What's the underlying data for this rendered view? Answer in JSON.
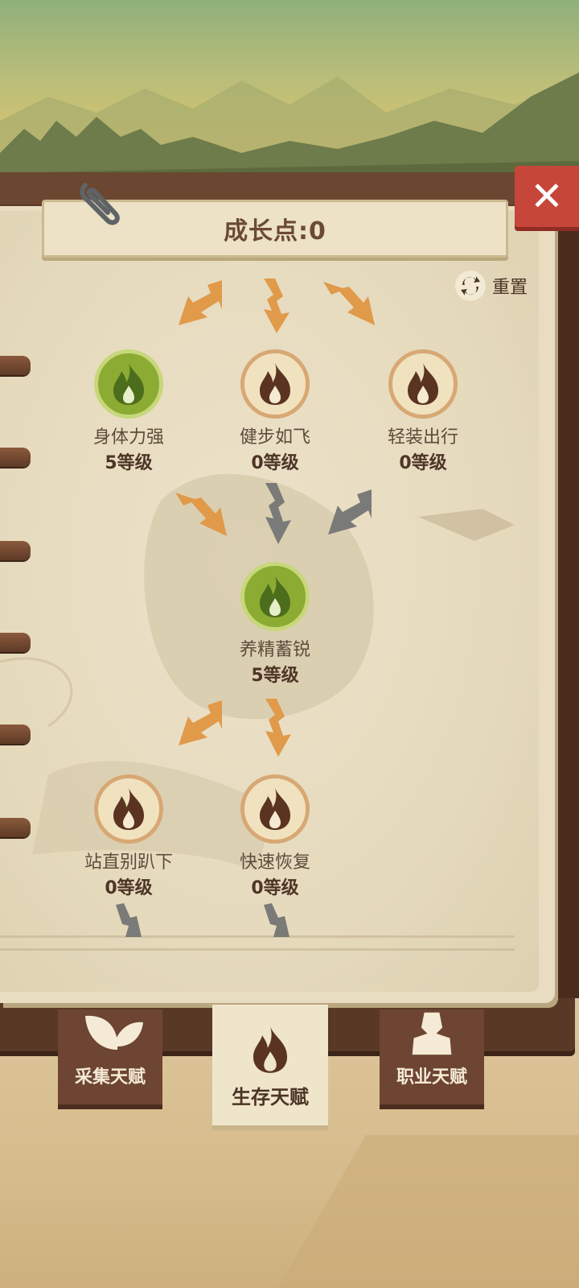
{
  "header": {
    "title": "成长点:0",
    "reset_label": "重置",
    "close_glyph": "✕"
  },
  "talents": [
    {
      "name": "身体力强",
      "level": "5等级",
      "state": "active"
    },
    {
      "name": "健步如飞",
      "level": "0等级",
      "state": "locked"
    },
    {
      "name": "轻装出行",
      "level": "0等级",
      "state": "locked"
    },
    {
      "name": "养精蓄锐",
      "level": "5等级",
      "state": "active"
    },
    {
      "name": "站直别趴下",
      "level": "0等级",
      "state": "locked"
    },
    {
      "name": "快速恢复",
      "level": "0等级",
      "state": "locked"
    }
  ],
  "tabs": [
    {
      "label": "采集天赋",
      "icon": "leaf-icon",
      "selected": false
    },
    {
      "label": "生存天赋",
      "icon": "fire-icon",
      "selected": true
    },
    {
      "label": "职业天赋",
      "icon": "person-icon",
      "selected": false
    }
  ],
  "colors": {
    "active_ring": "#8bab33",
    "locked_ring": "#d7a874",
    "arrow_orange": "#e09a4a",
    "arrow_gray": "#7a7a78",
    "close_red": "#c7463a",
    "tab_brown": "#6d4532"
  }
}
